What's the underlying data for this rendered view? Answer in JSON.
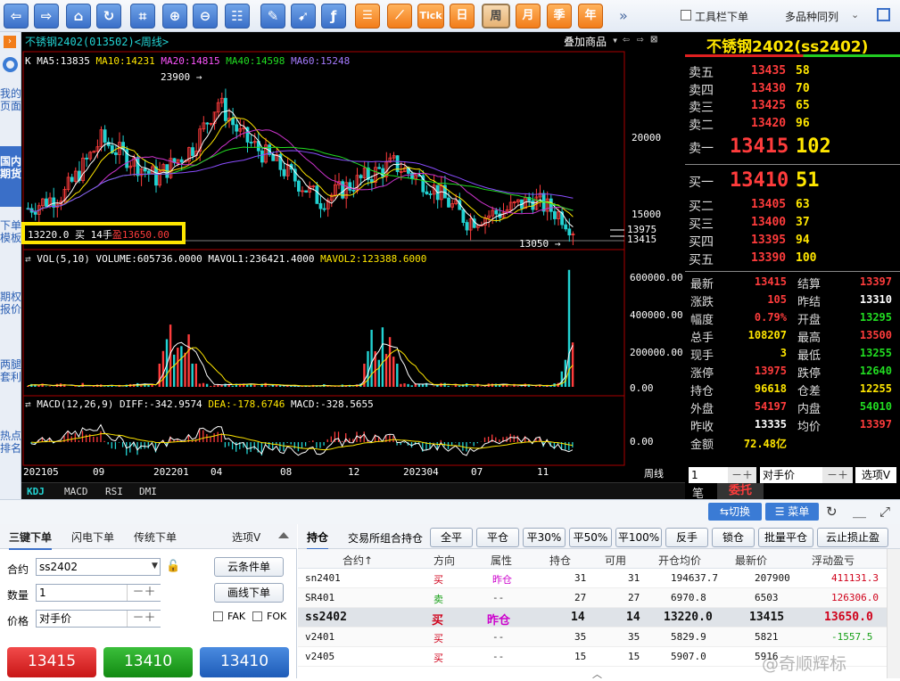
{
  "toolbar": {
    "buttons": [
      "back",
      "forward",
      "home",
      "refresh",
      "crop",
      "zoom-in",
      "zoom-out",
      "settings-grid",
      "draw",
      "cursor",
      "function",
      "list",
      "analysis"
    ],
    "tick": "Tick",
    "periods": [
      "日",
      "周",
      "月",
      "季",
      "年"
    ],
    "active_period": "周",
    "more": "»",
    "toolbar_order_label": "工具栏下单",
    "multi_layout_label": "多品种同列"
  },
  "rail": {
    "items": [
      "我的页面",
      "国内期货",
      "下单模板",
      "期权报价",
      "两腿套利",
      "热点排名"
    ],
    "active": "国内期货"
  },
  "chart": {
    "title": "不锈钢2402(013502)<周线>",
    "overlay_label": "叠加商品",
    "ma_line": {
      "k": "K",
      "ma5": "MA5:13835",
      "ma10": "MA10:14231",
      "ma20": "MA20:14815",
      "ma40": "MA40:14598",
      "ma60": "MA60:15248"
    },
    "high_label": "23900",
    "low_label": "13050",
    "price_axis": [
      "20000",
      "15000",
      "13975",
      "13415"
    ],
    "position_box": {
      "price": "13220.0",
      "side": "买",
      "qty": "14手",
      "profit": "盈13650.00"
    },
    "vol_line": {
      "name": "VOL(5,10)",
      "volume": "VOLUME:605736.0000",
      "mavol1": "MAVOL1:236421.4000",
      "mavol2": "MAVOL2:123388.6000"
    },
    "vol_axis": [
      "600000.00",
      "400000.00",
      "200000.00",
      "0.00"
    ],
    "macd_line": {
      "name": "MACD(12,26,9)",
      "diff": "DIFF:-342.9574",
      "dea": "DEA:-178.6746",
      "macd": "MACD:-328.5655"
    },
    "macd_axis": [
      "0.00"
    ],
    "x_axis": [
      "202105",
      "09",
      "202201",
      "04",
      "08",
      "12",
      "202304",
      "07",
      "11"
    ],
    "period_label": "周线",
    "indicator_tabs": [
      "KDJ",
      "MACD",
      "RSI",
      "DMI"
    ]
  },
  "quote": {
    "title": "不锈钢2402(ss2402)",
    "asks": [
      {
        "label": "卖五",
        "price": "13435",
        "vol": "58"
      },
      {
        "label": "卖四",
        "price": "13430",
        "vol": "70"
      },
      {
        "label": "卖三",
        "price": "13425",
        "vol": "65"
      },
      {
        "label": "卖二",
        "price": "13420",
        "vol": "96"
      },
      {
        "label": "卖一",
        "price": "13415",
        "vol": "102"
      }
    ],
    "bids": [
      {
        "label": "买一",
        "price": "13410",
        "vol": "51"
      },
      {
        "label": "买二",
        "price": "13405",
        "vol": "63"
      },
      {
        "label": "买三",
        "price": "13400",
        "vol": "37"
      },
      {
        "label": "买四",
        "price": "13395",
        "vol": "94"
      },
      {
        "label": "买五",
        "price": "13390",
        "vol": "100"
      }
    ],
    "stats": [
      {
        "l1": "最新",
        "v1": "13415",
        "c1": "#ff3c3c",
        "l2": "结算",
        "v2": "13397",
        "c2": "#ff3c3c"
      },
      {
        "l1": "涨跌",
        "v1": "105",
        "c1": "#ff3c3c",
        "l2": "昨结",
        "v2": "13310",
        "c2": "#ffffff"
      },
      {
        "l1": "幅度",
        "v1": "0.79%",
        "c1": "#ff3c3c",
        "l2": "开盘",
        "v2": "13295",
        "c2": "#22dd22"
      },
      {
        "l1": "总手",
        "v1": "108207",
        "c1": "#ffe600",
        "l2": "最高",
        "v2": "13500",
        "c2": "#ff3c3c"
      },
      {
        "l1": "现手",
        "v1": "3",
        "c1": "#ffe600",
        "l2": "最低",
        "v2": "13255",
        "c2": "#22dd22"
      },
      {
        "l1": "涨停",
        "v1": "13975",
        "c1": "#ff3c3c",
        "l2": "跌停",
        "v2": "12640",
        "c2": "#22dd22"
      },
      {
        "l1": "持仓",
        "v1": "96618",
        "c1": "#ffe600",
        "l2": "仓差",
        "v2": "12255",
        "c2": "#ffe600"
      },
      {
        "l1": "外盘",
        "v1": "54197",
        "c1": "#ff3c3c",
        "l2": "内盘",
        "v2": "54010",
        "c2": "#22dd22"
      },
      {
        "l1": "昨收",
        "v1": "13335",
        "c1": "#ffffff",
        "l2": "均价",
        "v2": "13397",
        "c2": "#ff3c3c"
      },
      {
        "l1": "金额",
        "v1": "72.48亿",
        "c1": "#ffe600",
        "l2": "",
        "v2": "",
        "c2": "#ffffff"
      }
    ],
    "order_qty": "1",
    "order_price": "对手价",
    "options_label": "选项V",
    "tabs": [
      "笔",
      "委托"
    ]
  },
  "bottom_bar": {
    "switch_label": "切换",
    "menu_label": "菜单"
  },
  "order_panel": {
    "tabs": [
      "三键下单",
      "闪电下单",
      "传统下单"
    ],
    "options": "选项V",
    "contract_label": "合约",
    "contract_value": "ss2402",
    "qty_label": "数量",
    "qty_value": "1",
    "price_label": "价格",
    "price_value": "对手价",
    "cloud_btn": "云条件单",
    "line_btn": "画线下单",
    "fak": "FAK",
    "fok": "FOK",
    "sell_price": "13415",
    "buy_price": "13410",
    "third_price": "13410"
  },
  "positions": {
    "tabs": [
      "持仓",
      "交易所组合持仓",
      "全平",
      "平仓",
      "平30%",
      "平50%",
      "平100%",
      "反手",
      "锁仓",
      "批量平仓",
      "云止损止盈"
    ],
    "headers": [
      "合约↑",
      "方向",
      "属性",
      "持仓",
      "可用",
      "开仓均价",
      "最新价",
      "浮动盈亏"
    ],
    "rows": [
      {
        "contract": "sn2401",
        "dir": "买",
        "attr": "昨仓",
        "pos": "31",
        "avail": "31",
        "open": "194637.7",
        "last": "207900",
        "pnl": "411131.3",
        "pnlc": "#d0021b",
        "dirc": "#d0021b",
        "attrc": "#cc00cc"
      },
      {
        "contract": "SR401",
        "dir": "卖",
        "attr": "--",
        "pos": "27",
        "avail": "27",
        "open": "6970.8",
        "last": "6503",
        "pnl": "126306.0",
        "pnlc": "#d0021b",
        "dirc": "#18a018",
        "attrc": "#333"
      },
      {
        "contract": "ss2402",
        "dir": "买",
        "attr": "昨仓",
        "pos": "14",
        "avail": "14",
        "open": "13220.0",
        "last": "13415",
        "pnl": "13650.0",
        "pnlc": "#d0021b",
        "dirc": "#d0021b",
        "attrc": "#cc00cc"
      },
      {
        "contract": "v2401",
        "dir": "买",
        "attr": "--",
        "pos": "35",
        "avail": "35",
        "open": "5829.9",
        "last": "5821",
        "pnl": "-1557.5",
        "pnlc": "#18a018",
        "dirc": "#d0021b",
        "attrc": "#333"
      },
      {
        "contract": "v2405",
        "dir": "买",
        "attr": "--",
        "pos": "15",
        "avail": "15",
        "open": "5907.0",
        "last": "5916",
        "pnl": "",
        "pnlc": "#d0021b",
        "dirc": "#d0021b",
        "attrc": "#333"
      }
    ],
    "watermark": "@奇顺辉标"
  },
  "colors": {
    "up": "#ff3c3c",
    "down": "#22d3d3",
    "ma5": "#ffffff",
    "ma10": "#ffe600",
    "ma20": "#cc33cc",
    "ma40": "#22dd22",
    "ma60": "#8a4dff"
  }
}
